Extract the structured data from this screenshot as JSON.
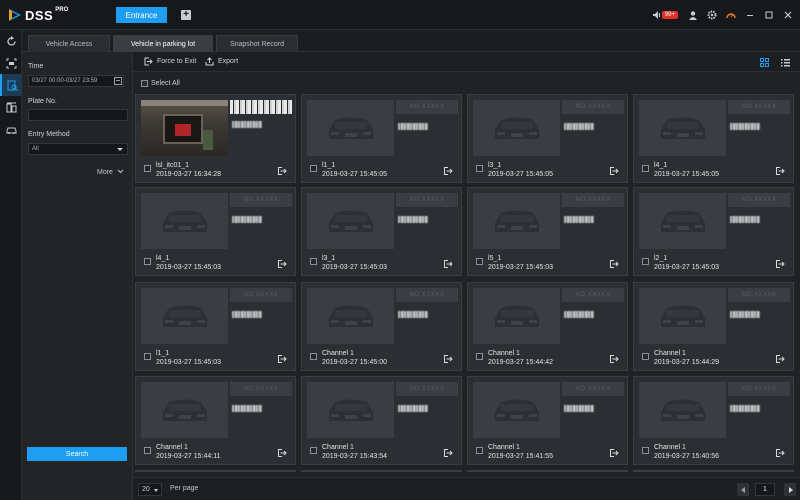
{
  "app": {
    "logo_text": "DSS",
    "logo_sup": "PRO",
    "entrance_label": "Entrance",
    "alarm_count": "99+"
  },
  "tabs": [
    {
      "label": "Vehicle Access"
    },
    {
      "label": "Vehicle in parking lot"
    },
    {
      "label": "Snapshot Record"
    }
  ],
  "filter": {
    "time_label": "Time",
    "time_value": "03/27 00:00-03/27 23:59",
    "plate_label": "Plate No.",
    "plate_value": "",
    "entry_label": "Entry Method",
    "entry_value": "All",
    "more_label": "More",
    "search_label": "Search"
  },
  "toolbar": {
    "force_exit_label": "Force to Exit",
    "export_label": "Export"
  },
  "select_all_label": "Select All",
  "plate_placeholder": "NO.XXXXX",
  "cards": [
    {
      "name": "lsl_itc01_1",
      "time": "2019-03-27 16:34:28"
    },
    {
      "name": "l1_1",
      "time": "2019-03-27 15:45:05"
    },
    {
      "name": "l3_1",
      "time": "2019-03-27 15:45:05"
    },
    {
      "name": "l4_1",
      "time": "2019-03-27 15:45:05"
    },
    {
      "name": "l4_1",
      "time": "2019-03-27 15:45:03"
    },
    {
      "name": "l3_1",
      "time": "2019-03-27 15:45:03"
    },
    {
      "name": "l5_1",
      "time": "2019-03-27 15:45:03"
    },
    {
      "name": "l2_1",
      "time": "2019-03-27 15:45:03"
    },
    {
      "name": "l1_1",
      "time": "2019-03-27 15:45:03"
    },
    {
      "name": "Channel 1",
      "time": "2019-03-27 15:45:00"
    },
    {
      "name": "Channel 1",
      "time": "2019-03-27 15:44:42"
    },
    {
      "name": "Channel 1",
      "time": "2019-03-27 15:44:29"
    },
    {
      "name": "Channel 1",
      "time": "2019-03-27 15:44:11"
    },
    {
      "name": "Channel 1",
      "time": "2019-03-27 15:43:54"
    },
    {
      "name": "Channel 1",
      "time": "2019-03-27 15:41:55"
    },
    {
      "name": "Channel 1",
      "time": "2019-03-27 15:40:56"
    }
  ],
  "pager": {
    "per_page_value": "20",
    "per_page_label": "Per page",
    "current_page": "1"
  },
  "colors": {
    "accent": "#1e9ef2",
    "alarm": "#e0302a"
  }
}
